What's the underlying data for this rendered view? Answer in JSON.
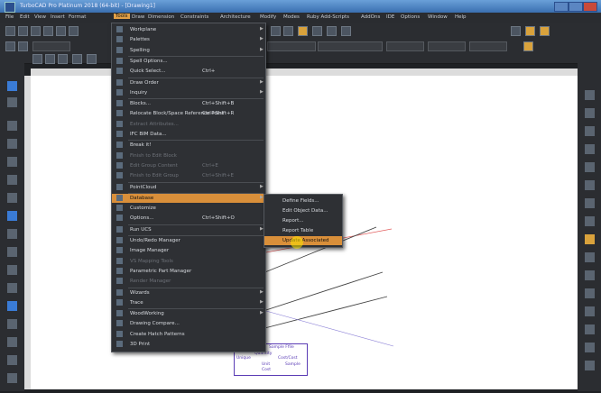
{
  "window": {
    "title": "TurboCAD Pro Platinum 2018 (64-bit) - [Drawing1]"
  },
  "menubar": {
    "items": [
      "File",
      "Edit",
      "View",
      "Insert",
      "Format",
      "Tools",
      "Draw",
      "Dimension",
      "Constraints",
      "Architecture",
      "Modify",
      "Modes",
      "Ruby Add-Scripts",
      "AddOns",
      "IDE",
      "Options",
      "Window",
      "Help"
    ],
    "active": "Tools"
  },
  "tools_menu": {
    "items": [
      {
        "label": "Workplane",
        "shortcut": "",
        "submenu": true,
        "disabled": false
      },
      {
        "label": "Palettes",
        "shortcut": "",
        "submenu": true,
        "disabled": false
      },
      {
        "label": "Spelling",
        "shortcut": "",
        "submenu": true,
        "disabled": false
      },
      {
        "label": "Spell Options...",
        "shortcut": "",
        "submenu": false,
        "disabled": false
      },
      {
        "label": "Quick Select...",
        "shortcut": "Ctrl+",
        "submenu": false,
        "disabled": false
      },
      {
        "label": "Draw Order",
        "shortcut": "",
        "submenu": true,
        "disabled": false
      },
      {
        "label": "Inquiry",
        "shortcut": "",
        "submenu": true,
        "disabled": false
      },
      {
        "label": "Blocks...",
        "shortcut": "Ctrl+Shift+B",
        "submenu": false,
        "disabled": false
      },
      {
        "label": "Relocate Block/Space Reference Point",
        "shortcut": "Ctrl+Shift+R",
        "submenu": false,
        "disabled": false
      },
      {
        "label": "Extract Attributes...",
        "shortcut": "",
        "submenu": false,
        "disabled": true
      },
      {
        "label": "IFC BIM Data...",
        "shortcut": "",
        "submenu": false,
        "disabled": false
      },
      {
        "label": "Break it!",
        "shortcut": "",
        "submenu": false,
        "disabled": false
      },
      {
        "label": "Finish to Edit Block",
        "shortcut": "",
        "submenu": false,
        "disabled": true
      },
      {
        "label": "Edit Group Content",
        "shortcut": "Ctrl+E",
        "submenu": false,
        "disabled": true
      },
      {
        "label": "Finish to Edit Group",
        "shortcut": "Ctrl+Shift+E",
        "submenu": false,
        "disabled": true
      },
      {
        "label": "PointCloud",
        "shortcut": "",
        "submenu": true,
        "disabled": false
      },
      {
        "label": "Database",
        "shortcut": "",
        "submenu": true,
        "disabled": false,
        "highlighted": true
      },
      {
        "label": "Customize",
        "shortcut": "",
        "submenu": false,
        "disabled": false
      },
      {
        "label": "Options...",
        "shortcut": "Ctrl+Shift+O",
        "submenu": false,
        "disabled": false
      },
      {
        "label": "Run UCS",
        "shortcut": "",
        "submenu": true,
        "disabled": false
      },
      {
        "label": "Undo/Redo Manager",
        "shortcut": "",
        "submenu": false,
        "disabled": false
      },
      {
        "label": "Image Manager",
        "shortcut": "",
        "submenu": false,
        "disabled": false
      },
      {
        "label": "VS Mapping Tools",
        "shortcut": "",
        "submenu": false,
        "disabled": true
      },
      {
        "label": "Parametric Part Manager",
        "shortcut": "",
        "submenu": false,
        "disabled": false
      },
      {
        "label": "Render Manager",
        "shortcut": "",
        "submenu": false,
        "disabled": true
      },
      {
        "label": "Wizards",
        "shortcut": "",
        "submenu": true,
        "disabled": false
      },
      {
        "label": "Trace",
        "shortcut": "",
        "submenu": true,
        "disabled": false
      },
      {
        "label": "WoodWorking",
        "shortcut": "",
        "submenu": true,
        "disabled": false
      },
      {
        "label": "Drawing Compare...",
        "shortcut": "",
        "submenu": false,
        "disabled": false
      },
      {
        "label": "Create Hatch Patterns",
        "shortcut": "",
        "submenu": false,
        "disabled": false
      },
      {
        "label": "3D Print",
        "shortcut": "",
        "submenu": false,
        "disabled": false
      }
    ]
  },
  "database_submenu": {
    "items": [
      {
        "label": "Define Fields...",
        "highlighted": false
      },
      {
        "label": "Edit Object Data...",
        "highlighted": false
      },
      {
        "label": "Report...",
        "highlighted": false
      },
      {
        "label": "Report Table",
        "highlighted": false
      },
      {
        "label": "Update Associated",
        "highlighted": true
      }
    ]
  },
  "table": {
    "cells": [
      "Sample Ffile",
      "Quantity",
      "Unique",
      "Cost/Cost",
      "Unit",
      "Cost",
      "Sample"
    ]
  },
  "colors": {
    "menu_highlight": "#d98f3a",
    "active_menu": "#e2a047",
    "title_bar": "#3a6fb0"
  }
}
